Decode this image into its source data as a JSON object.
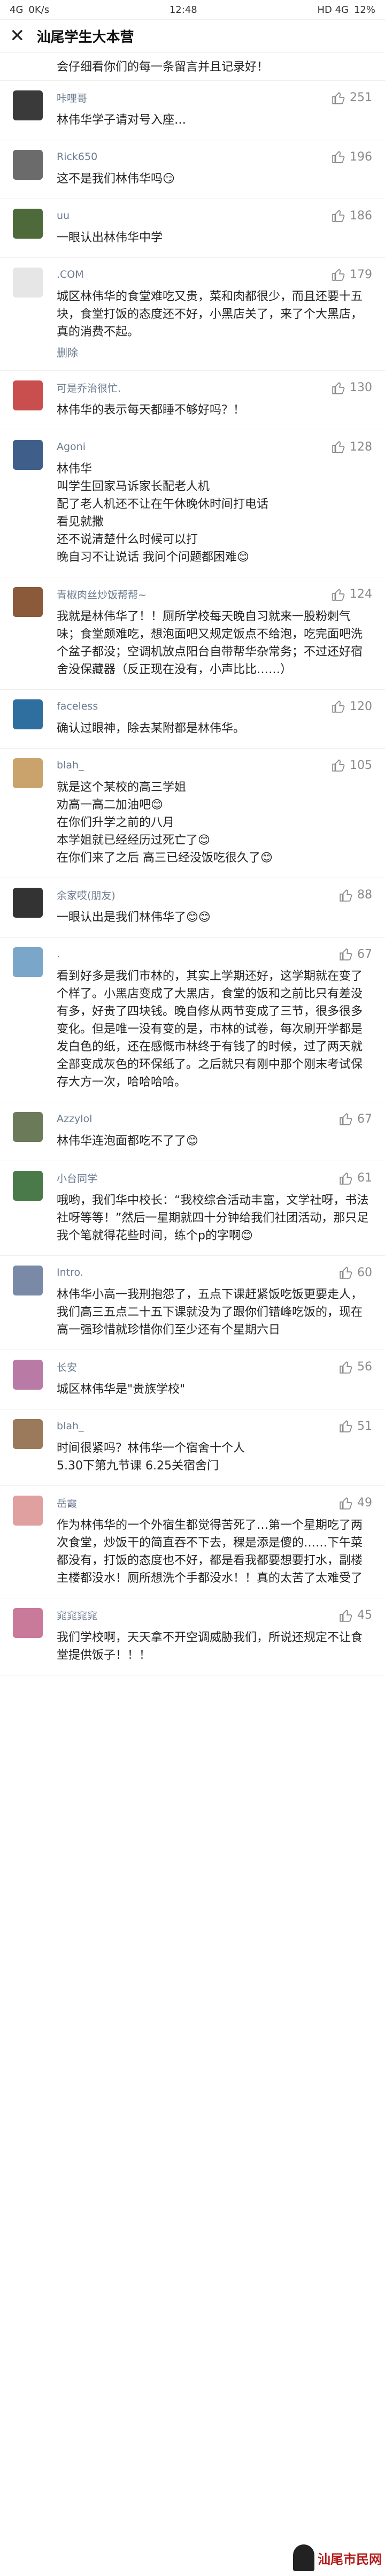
{
  "status": {
    "left": "4G",
    "speed": "0K/s",
    "time": "12:48",
    "right": "HD 4G",
    "battery": "12%"
  },
  "header": {
    "title": "汕尾学生大本营"
  },
  "top_text": "会仔细看你们的每一条留言并且记录好！",
  "colors": {
    "avatar_0": "#3a3a3a",
    "avatar_1": "#6b6b6b",
    "avatar_2": "#4f6a3a",
    "avatar_3": "#e6e6e6",
    "avatar_4": "#c94f4f",
    "avatar_5": "#3f5f8a",
    "avatar_6": "#8a5a3a",
    "avatar_7": "#2f6f9f",
    "avatar_8": "#c9a36b",
    "avatar_9": "#333333",
    "avatar_10": "#7aa6c9",
    "avatar_11": "#6b7b5a",
    "avatar_12": "#4a7a4a",
    "avatar_13": "#7a8aa6",
    "avatar_14": "#b97aa6",
    "avatar_15": "#9a7a5a",
    "avatar_16": "#e0a0a0",
    "avatar_17": "#c97a9a"
  },
  "comments": [
    {
      "user": "咔哩哥",
      "likes": "251",
      "text": "林伟华学子请对号入座…"
    },
    {
      "user": "Rick650",
      "likes": "196",
      "text": "这不是我们林伟华吗😏"
    },
    {
      "user": "uu",
      "likes": "186",
      "text": "一眼认出林伟华中学"
    },
    {
      "user": ".COM",
      "likes": "179",
      "text": "城区林伟华的食堂难吃又贵，菜和肉都很少，而且还要十五块，食堂打饭的态度还不好，小黑店关了，来了个大黑店，真的消费不起。",
      "delete": "删除"
    },
    {
      "user": "可是乔治很忙.",
      "likes": "130",
      "text": "林伟华的表示每天都睡不够好吗？！"
    },
    {
      "user": "Agoni",
      "likes": "128",
      "text": "林伟华\n叫学生回家马诉家长配老人机\n配了老人机还不让在午休晚休时间打电话\n看见就撒\n还不说清楚什么时候可以打\n晚自习不让说话 我问个问题都困难😊"
    },
    {
      "user": "青椒肉丝炒饭帮帮~",
      "likes": "124",
      "text": "我就是林伟华了！！厕所学校每天晚自习就来一股粉刺气味；食堂颇难吃，想泡面吧又规定饭点不给泡，吃完面吧洗个盆子都没；空调机放点阳台自带帮华杂常务；不过还好宿舍没保藏器（反正现在没有，小声比比……）"
    },
    {
      "user": "faceless",
      "likes": "120",
      "text": "确认过眼神，除去某附都是林伟华。"
    },
    {
      "user": "blah_",
      "likes": "105",
      "text": "就是这个某校的高三学姐\n劝高一高二加油吧😊\n在你们升学之前的八月\n本学姐就已经经历过死亡了😊\n在你们来了之后 高三已经没饭吃很久了😊"
    },
    {
      "user": "余家哎(朋友)",
      "likes": "88",
      "text": "一眼认出是我们林伟华了😊😊"
    },
    {
      "user": ".",
      "likes": "67",
      "text": "看到好多是我们市林的，其实上学期还好，这学期就在变了个样了。小黑店变成了大黑店，食堂的饭和之前比只有差没有多，好贵了四块钱。晚自修从两节变成了三节，很多很多变化。但是唯一没有变的是，市林的试卷，每次刷开学都是发白色的纸，还在感慨市林终于有钱了的时候，过了两天就全部变成灰色的环保纸了。之后就只有刚中那个刚末考试保存大方一次，哈哈哈哈。"
    },
    {
      "user": "Azzylol",
      "likes": "67",
      "text": "林伟华连泡面都吃不了了😊"
    },
    {
      "user": "小台同学",
      "likes": "61",
      "text": "哦哟，我们华中校长：“我校综合活动丰富，文学社呀，书法社呀等等！”然后一星期就四十分钟给我们社团活动，那只足我个笔就得花些时间，练个p的字啊😊"
    },
    {
      "user": "Intro.",
      "likes": "60",
      "text": "林伟华小高一我刑抱怨了，五点下课赶紧饭吃饭更要走人，我们高三五点二十五下课就没为了跟你们错峰吃饭的，现在高一强珍惜就珍惜你们至少还有个星期六日"
    },
    {
      "user": "长安",
      "likes": "56",
      "text": "城区林伟华是\"贵族学校\""
    },
    {
      "user": "blah_",
      "likes": "51",
      "text": "时间很紧吗？林伟华一个宿舍十个人\n5.30下第九节课 6.25关宿舍门"
    },
    {
      "user": "岳霞",
      "likes": "49",
      "text": "作为林伟华的一个外宿生都觉得苦死了…第一个星期吃了两次食堂，炒饭干的简直吞不下去，稞是添是傻的……下午菜都没有，打饭的态度也不好，都是看我都要想要打水，副楼主楼都没水！厕所想洗个手都没水！！真的太苦了太难受了"
    },
    {
      "user": "窕窕窕窕",
      "likes": "45",
      "text": "我们学校啊，天天拿不开空调威胁我们，所说还规定不让食堂提供饭子！！！"
    }
  ],
  "watermark": {
    "text": "汕尾市民网",
    "icon": "figure-icon"
  }
}
